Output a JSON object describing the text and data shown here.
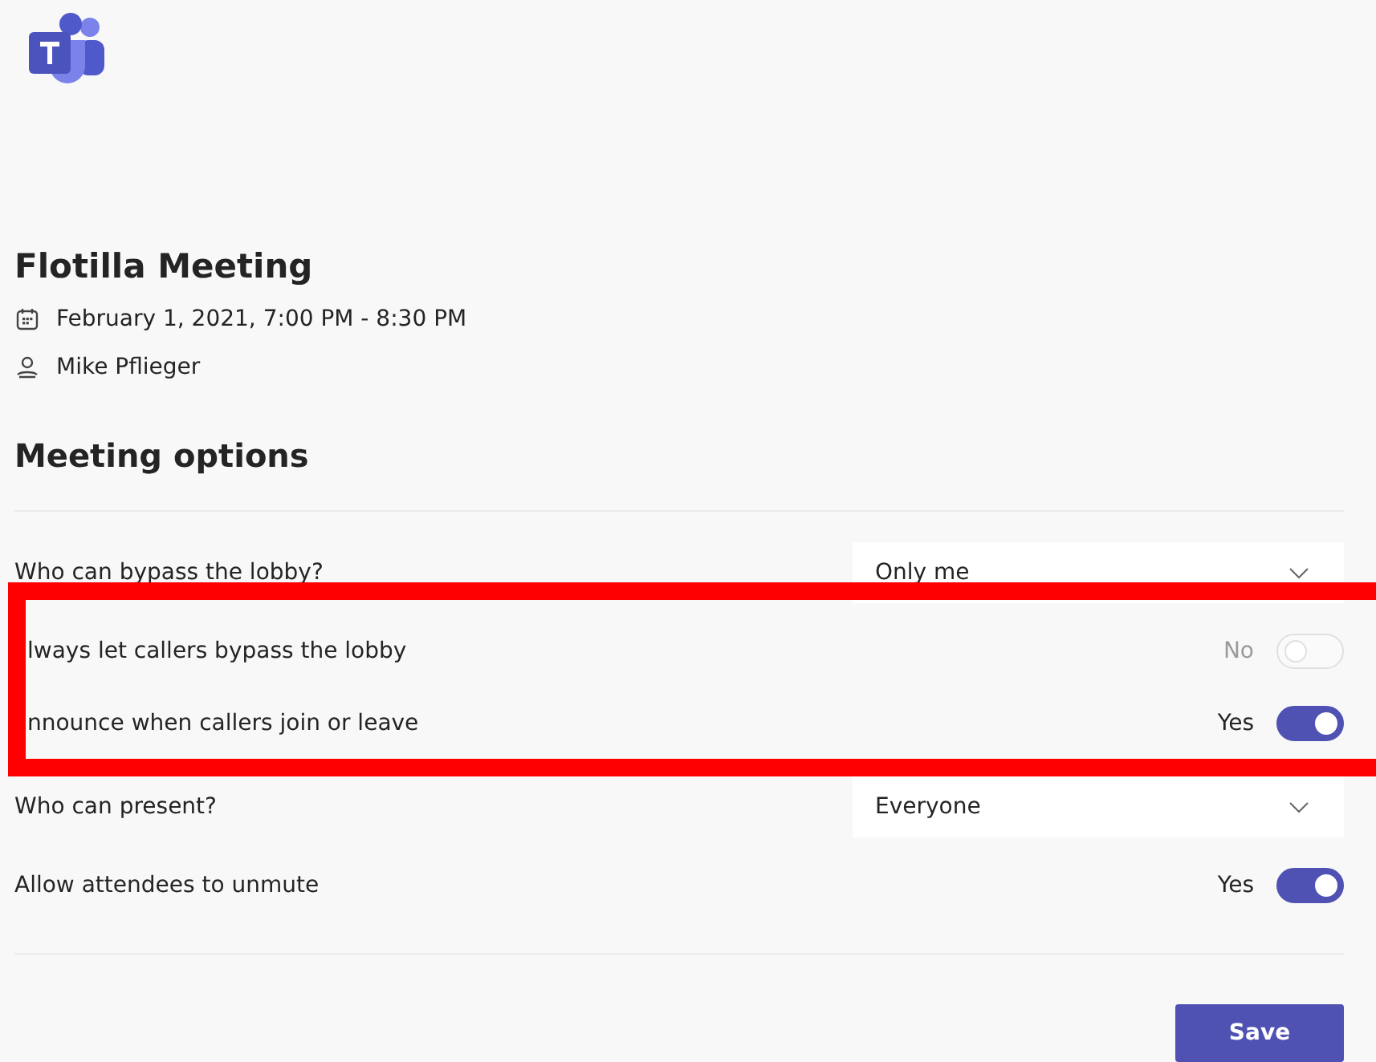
{
  "meeting": {
    "title": "Flotilla Meeting",
    "date": "February 1, 2021, 7:00 PM - 8:30 PM",
    "organizer": "Mike Pflieger"
  },
  "section_title": "Meeting options",
  "options": [
    {
      "kind": "dropdown",
      "label": "Who can bypass the lobby?",
      "value": "Only me",
      "highlighted": false
    },
    {
      "kind": "toggle",
      "label": "lways let callers bypass the lobby",
      "state_text": "No",
      "on": false,
      "disabled": true,
      "highlighted": true
    },
    {
      "kind": "toggle",
      "label": "nnounce when callers join or leave",
      "state_text": "Yes",
      "on": true,
      "disabled": false,
      "highlighted": true
    },
    {
      "kind": "dropdown",
      "label": "Who can present?",
      "value": "Everyone",
      "highlighted": false
    },
    {
      "kind": "toggle",
      "label": "Allow attendees to unmute",
      "state_text": "Yes",
      "on": true,
      "disabled": false,
      "highlighted": false
    }
  ],
  "save_button": "Save"
}
